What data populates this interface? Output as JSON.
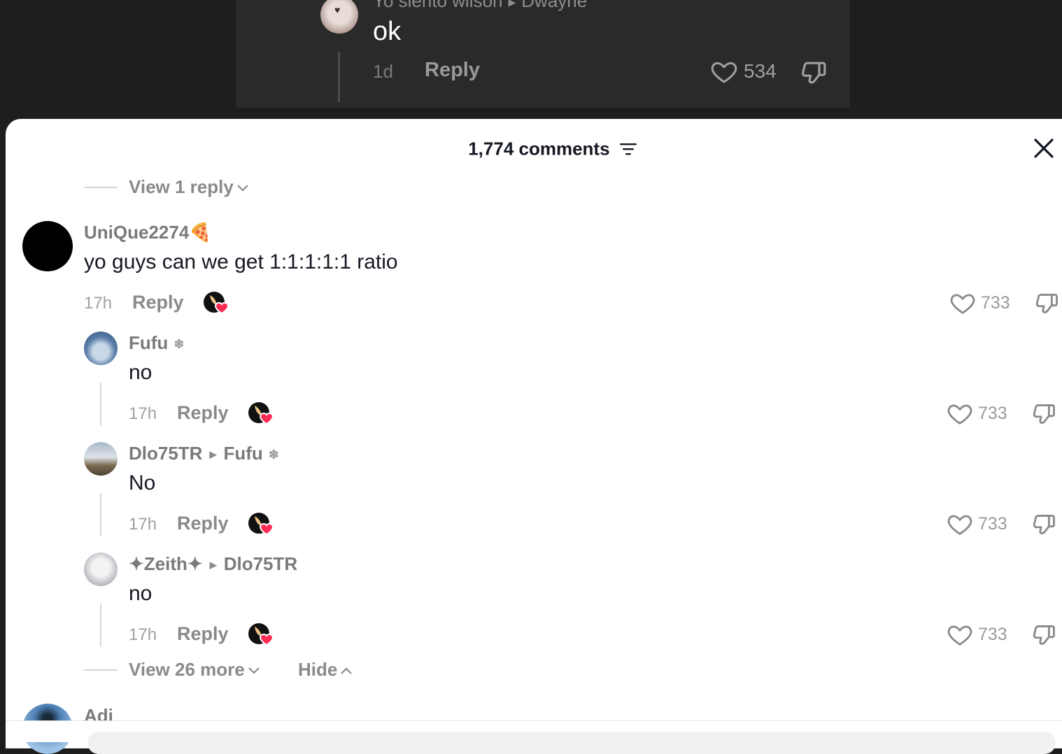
{
  "background_comment": {
    "username": "Yo siento wilson",
    "reply_to": "Dwayne",
    "text": "ok",
    "time": "1d",
    "reply_label": "Reply",
    "likes": "534"
  },
  "sheet": {
    "title": "1,774 comments"
  },
  "view_reply_label": "View 1 reply",
  "comments": [
    {
      "username": "UniQue2274",
      "emoji": "🍕",
      "text": "yo guys can we get 1:1:1:1:1 ratio",
      "time": "17h",
      "reply_label": "Reply",
      "likes": "733"
    },
    {
      "username": "Fufu",
      "badge": "❄",
      "text": "no",
      "time": "17h",
      "reply_label": "Reply",
      "likes": "733"
    },
    {
      "username": "Dlo75TR",
      "reply_to": "Fufu",
      "reply_to_badge": "❄",
      "text": "No",
      "time": "17h",
      "reply_label": "Reply",
      "likes": "733"
    },
    {
      "username": "✦Zeith✦",
      "reply_to": "Dlo75TR",
      "text": "no",
      "time": "17h",
      "reply_label": "Reply",
      "likes": "733"
    }
  ],
  "view_more_label": "View 26 more",
  "hide_label": "Hide",
  "next_comment": {
    "username": "Adi"
  },
  "icons": {
    "heart": "heart-outline-icon",
    "dislike": "thumbs-down-outline-icon",
    "close": "close-icon",
    "filter": "sort-filter-icon",
    "creator_liked": "creator-liked-icon"
  }
}
